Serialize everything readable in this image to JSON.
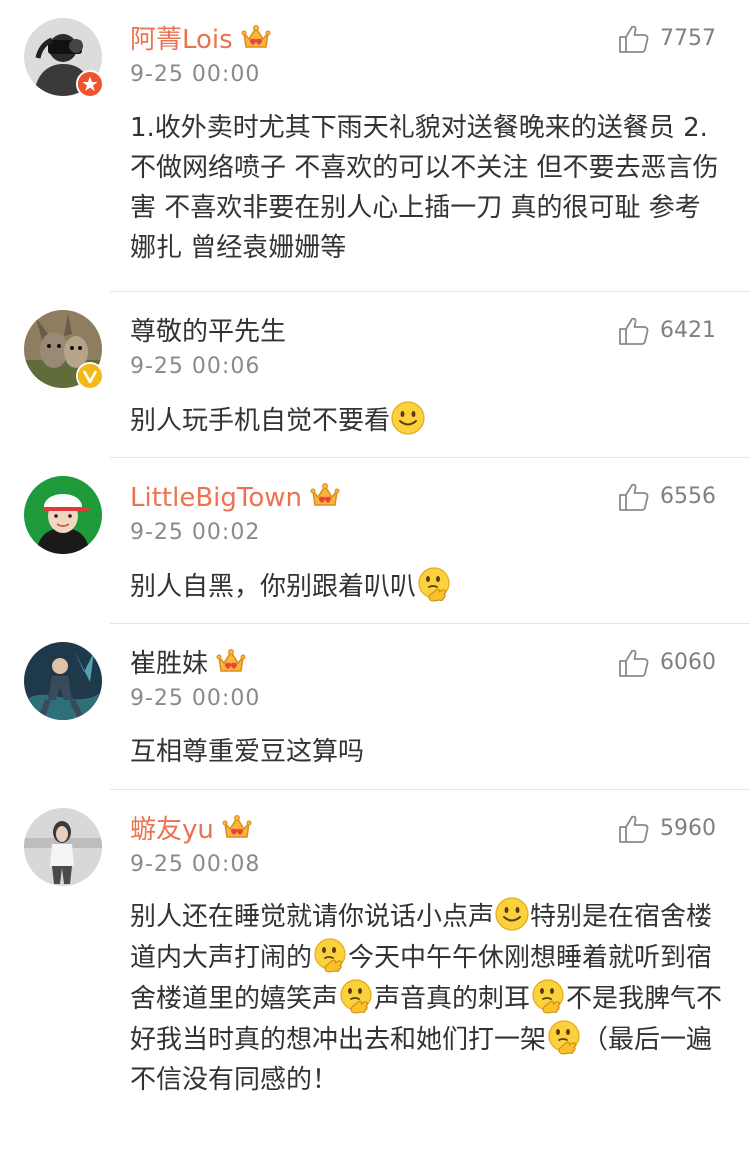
{
  "comments": [
    {
      "username": "阿菁Lois",
      "vip": true,
      "badge_icon": "orange-star-badge",
      "time": "9-25 00:00",
      "likes": "7757",
      "text": "1.收外卖时尤其下雨天礼貌对送餐晚来的送餐员 2.不做网络喷子 不喜欢的可以不关注 但不要去恶言伤害 不喜欢非要在别人心上插一刀 真的很可耻 参考 娜扎 曾经袁姗姗等"
    },
    {
      "username": "尊敬的平先生",
      "vip": false,
      "badge_icon": "yellow-v-badge",
      "time": "9-25 00:06",
      "likes": "6421",
      "text": "别人玩手机自觉不要看",
      "emoji": "smile-emoji"
    },
    {
      "username": "LittleBigTown",
      "vip": true,
      "time": "9-25 00:02",
      "likes": "6556",
      "text": "别人自黑，你别跟着叭叭",
      "emoji": "thinking-emoji"
    },
    {
      "username": "崔胜妹",
      "vip": true,
      "time": "9-25 00:00",
      "likes": "6060",
      "text": "互相尊重爱豆这算吗"
    },
    {
      "username": "蝣友yu",
      "vip": true,
      "time": "9-25 00:08",
      "likes": "5960",
      "text_parts": [
        "别人还在睡觉就请你说话小点声",
        "特别是在宿舍楼道内大声打闹的",
        "今天中午午休刚想睡着就听到宿舍楼道里的嬉笑声",
        "声音真的刺耳",
        "不是我脾气不好我当时真的想冲出去和她们打一架",
        "（最后一遍不信没有同感的！"
      ],
      "emojis": [
        "smile-emoji",
        "thinking-emoji",
        "thinking-emoji",
        "thinking-emoji",
        "thinking-emoji"
      ]
    }
  ],
  "colors": {
    "vip_name": "#eb7350",
    "plain_name": "#333333",
    "timestamp": "#8a8a8a",
    "like_count": "#808080",
    "divider": "#e6e6e6"
  }
}
